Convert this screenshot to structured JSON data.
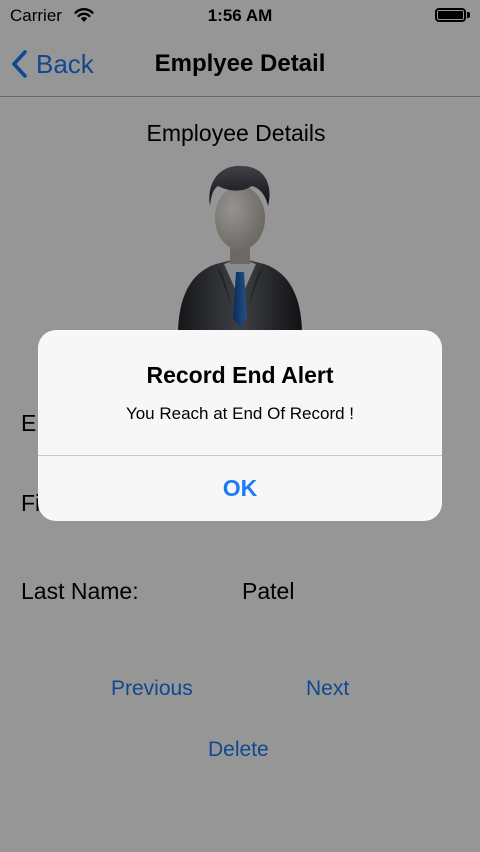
{
  "status_bar": {
    "carrier": "Carrier",
    "time": "1:56 AM"
  },
  "nav_bar": {
    "back_label": "Back",
    "title": "Emplyee Detail"
  },
  "screen": {
    "section_title": "Employee Details",
    "fields": [
      {
        "label": "Em",
        "value": ""
      },
      {
        "label": "Fi",
        "value": ""
      },
      {
        "label": "Last Name:",
        "value": "Patel"
      }
    ],
    "buttons": {
      "previous": "Previous",
      "next": "Next",
      "delete": "Delete"
    }
  },
  "alert": {
    "title": "Record End Alert",
    "message": "You Reach at End Of Record !",
    "ok_label": "OK"
  },
  "colors": {
    "accent": "#1b7cf5",
    "overlay": "#000000",
    "alert_bg": "#f7f7f7"
  },
  "icons": {
    "back": "chevron-left-icon",
    "wifi": "wifi-icon",
    "battery": "battery-icon",
    "avatar": "businessman-avatar-icon"
  }
}
